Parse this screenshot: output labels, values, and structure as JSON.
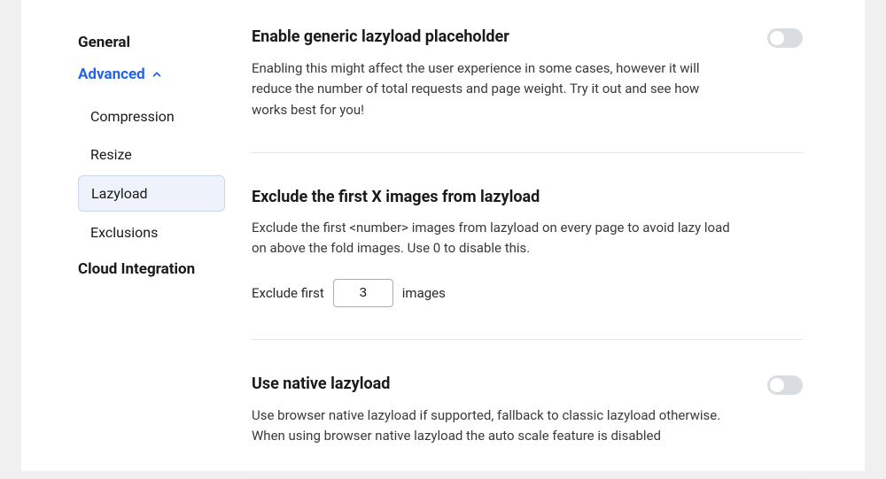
{
  "sidebar": {
    "items": [
      {
        "label": "General"
      },
      {
        "label": "Advanced"
      },
      {
        "label": "Cloud Integration"
      }
    ],
    "subitems": [
      {
        "label": "Compression"
      },
      {
        "label": "Resize"
      },
      {
        "label": "Lazyload"
      },
      {
        "label": "Exclusions"
      }
    ]
  },
  "sections": {
    "generic": {
      "title": "Enable generic lazyload placeholder",
      "desc": "Enabling this might affect the user experience in some cases, however it will reduce the number of total requests and page weight. Try it out and see how works best for you!"
    },
    "exclude": {
      "title": "Exclude the first X images from lazyload",
      "desc": "Exclude the first <number> images from lazyload on every page to avoid lazy load on above the fold images. Use 0 to disable this.",
      "prefix": "Exclude first",
      "value": "3",
      "suffix": "images"
    },
    "native": {
      "title": "Use native lazyload",
      "desc": "Use browser native lazyload if supported, fallback to classic lazyload otherwise. When using browser native lazyload the auto scale feature is disabled"
    }
  }
}
